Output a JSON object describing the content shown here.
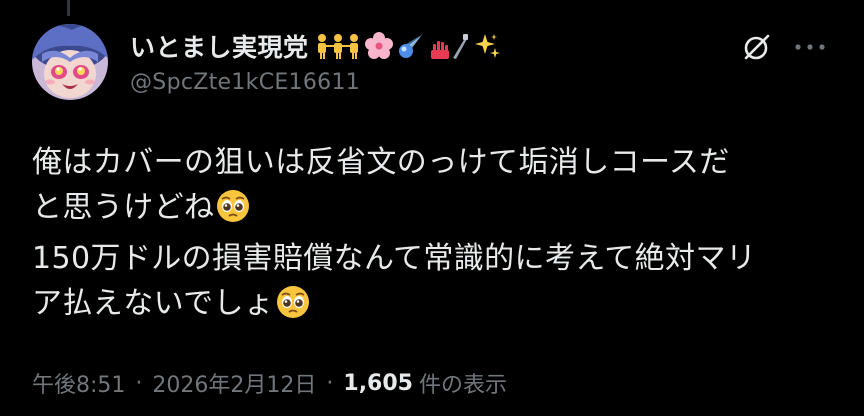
{
  "user": {
    "display_name": "いとまし実現党",
    "handle": "@SpcZte1kCE16611",
    "name_emojis": [
      "people-holding-hands-icon",
      "cherry-blossom-icon",
      "comet-icon",
      "nail-polish-icon",
      "syringe-icon",
      "sparkles-icon"
    ]
  },
  "header": {
    "grok_icon": "grok-icon",
    "more_icon": "more-options-icon"
  },
  "tweet": {
    "line1": "俺はカバーの狙いは反省文のっけて垢消しコースだ",
    "line2": "と思うけどね",
    "line3": "150万ドルの損害賠償なんて常識的に考えて絶対マリ",
    "line4": "ア払えないでしょ",
    "inline_emoji": "pleading-face-icon"
  },
  "meta": {
    "time": "午後8:51",
    "date": "2026年2月12日",
    "separator": "·",
    "views_count": "1,605",
    "views_label": "件の表示"
  },
  "colors": {
    "background": "#000000",
    "primary_text": "#e7e9ea",
    "secondary_text": "#71767b"
  }
}
